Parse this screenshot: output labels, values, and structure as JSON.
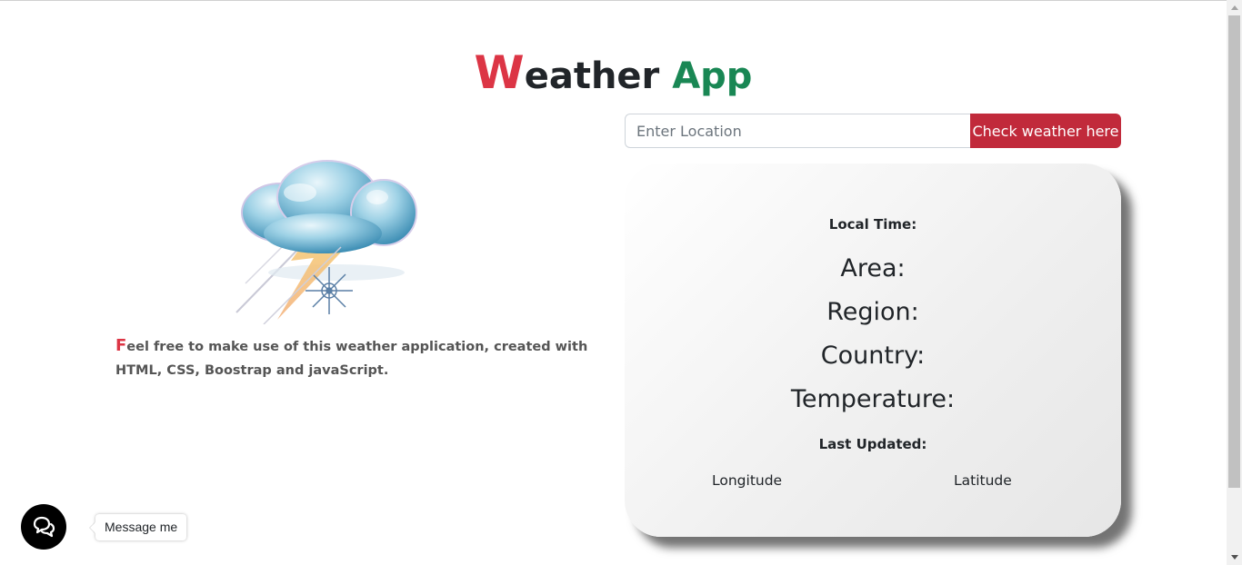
{
  "header": {
    "title_first_letter": "W",
    "title_rest": "eather",
    "title_app": "App"
  },
  "search": {
    "placeholder": "Enter Location",
    "value": "",
    "button_label": "Check weather here"
  },
  "intro": {
    "first_letter": "F",
    "text": "eel free to make use of this weather application, created with HTML, CSS, Boostrap and javaScript."
  },
  "weather_card": {
    "local_time_label": "Local Time:",
    "area_label": "Area:",
    "region_label": "Region:",
    "country_label": "Country:",
    "temperature_label": "Temperature:",
    "last_updated_label": "Last Updated:",
    "longitude_label": "Longitude",
    "latitude_label": "Latitude"
  },
  "chat": {
    "icon": "chat-bubbles-icon",
    "tooltip": "Message me"
  },
  "colors": {
    "accent_red": "#dc3545",
    "accent_green": "#198754",
    "button_red": "#c12a3b"
  }
}
